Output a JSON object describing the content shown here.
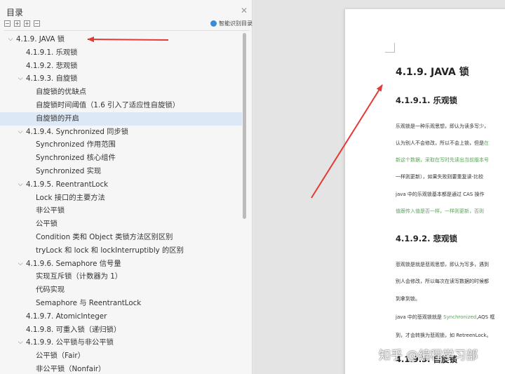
{
  "outline": {
    "title": "目录",
    "close_icon": "close-icon",
    "smart_label": "智能识别目录",
    "items": [
      {
        "level": 0,
        "toggle": "v",
        "text": "4.1.9. JAVA 锁"
      },
      {
        "level": 1,
        "toggle": "",
        "text": "4.1.9.1. 乐观锁"
      },
      {
        "level": 1,
        "toggle": "",
        "text": "4.1.9.2. 悲观锁"
      },
      {
        "level": 1,
        "toggle": "v",
        "text": "4.1.9.3. 自旋锁"
      },
      {
        "level": 2,
        "toggle": "",
        "text": "自旋锁的优缺点"
      },
      {
        "level": 2,
        "toggle": "",
        "text": "自旋锁时间阈值（1.6 引入了适应性自旋锁）"
      },
      {
        "level": 2,
        "toggle": "",
        "text": "自旋锁的开启",
        "selected": true
      },
      {
        "level": 1,
        "toggle": "v",
        "text": "4.1.9.4. Synchronized 同步锁"
      },
      {
        "level": 2,
        "toggle": "",
        "text": "Synchronized 作用范围"
      },
      {
        "level": 2,
        "toggle": "",
        "text": "Synchronized 核心组件"
      },
      {
        "level": 2,
        "toggle": "",
        "text": "Synchronized 实现"
      },
      {
        "level": 1,
        "toggle": "v",
        "text": "4.1.9.5. ReentrantLock"
      },
      {
        "level": 2,
        "toggle": "",
        "text": "Lock 接口的主要方法"
      },
      {
        "level": 2,
        "toggle": "",
        "text": "非公平锁"
      },
      {
        "level": 2,
        "toggle": "",
        "text": "公平锁"
      },
      {
        "level": 2,
        "toggle": "",
        "text": "Condition 类和 Object 类锁方法区别区别"
      },
      {
        "level": 2,
        "toggle": "",
        "text": "tryLock 和 lock 和 lockInterruptibly 的区别"
      },
      {
        "level": 1,
        "toggle": "v",
        "text": "4.1.9.6. Semaphore 信号量"
      },
      {
        "level": 2,
        "toggle": "",
        "text": "实现互斥锁（计数器为 1）"
      },
      {
        "level": 2,
        "toggle": "",
        "text": "代码实现"
      },
      {
        "level": 2,
        "toggle": "",
        "text": "Semaphore 与 ReentrantLock"
      },
      {
        "level": 1,
        "toggle": "",
        "text": "4.1.9.7. AtomicInteger"
      },
      {
        "level": 1,
        "toggle": "",
        "text": "4.1.9.8. 可重入锁（递归锁）"
      },
      {
        "level": 1,
        "toggle": "v",
        "text": "4.1.9.9. 公平锁与非公平锁"
      },
      {
        "level": 2,
        "toggle": "",
        "text": "公平锁（Fair）"
      },
      {
        "level": 2,
        "toggle": "",
        "text": "非公平锁（Nonfair）"
      }
    ]
  },
  "document": {
    "heading": "4.1.9. JAVA 锁",
    "sub1": "4.1.9.1. 乐观锁",
    "p1_1": "乐观锁是一种乐观思想，即认为读多写少，",
    "p1_2a": "认为别人不会修改，所以不会上锁，但是",
    "p1_2b": "在",
    "p1_3": "新这个数据，采取在写时先读出当前版本号",
    "p1_4": "一样则更新），如果失败则要重复读-比较",
    "p1_5": "java 中的乐观锁基本都是通过 CAS 操作",
    "p1_6": "值跟传入值是否一样，一样则更新，否则",
    "sub2": "4.1.9.2. 悲观锁",
    "p2_1": "悲观锁是就是悲观思想，即认为写多，遇到",
    "p2_2": "别人会修改，所以每次在读写数据的时候都",
    "p2_3": "到拿到锁。",
    "p2_4a": "java 中的悲观锁就是 ",
    "p2_4b": "Synchronized",
    "p2_4c": ",AQS 框",
    "p2_5": "到，才会转换为悲观锁，如 RetreenLock。",
    "sub3": "4.1.9.3. 自旋锁",
    "watermark": "知乎 @编程学习部"
  },
  "colors": {
    "arrow": "#e53935",
    "selected_bg": "#dde8f6",
    "highlight_text": "#5aa55a"
  }
}
